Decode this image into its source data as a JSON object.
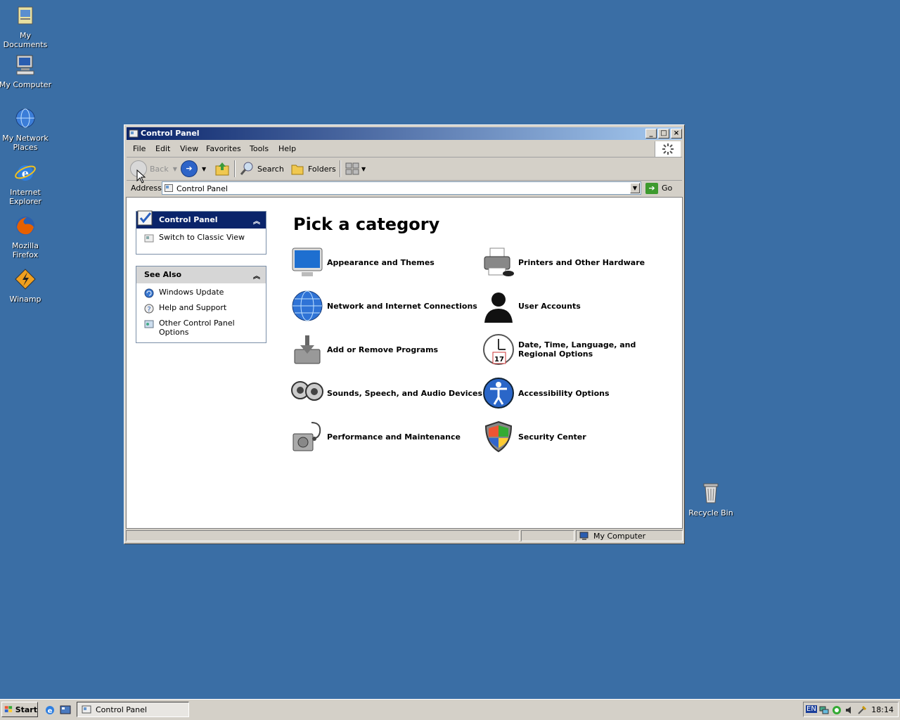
{
  "desktop": {
    "icons": [
      {
        "label": "My Documents"
      },
      {
        "label": "My Computer"
      },
      {
        "label": "My Network Places"
      },
      {
        "label": "Internet Explorer"
      },
      {
        "label": "Mozilla Firefox"
      },
      {
        "label": "Winamp"
      },
      {
        "label": "Recycle Bin"
      }
    ]
  },
  "window": {
    "title": "Control Panel",
    "menu": [
      "File",
      "Edit",
      "View",
      "Favorites",
      "Tools",
      "Help"
    ],
    "toolbar": {
      "back": "Back",
      "search": "Search",
      "folders": "Folders"
    },
    "address": {
      "label": "Address",
      "value": "Control Panel",
      "go": "Go"
    },
    "sidebar": {
      "panel1": {
        "title": "Control Panel",
        "link": "Switch to Classic View"
      },
      "panel2": {
        "title": "See Also",
        "links": [
          "Windows Update",
          "Help and Support",
          "Other Control Panel Options"
        ]
      }
    },
    "heading": "Pick a category",
    "categories": [
      "Appearance and Themes",
      "Printers and Other Hardware",
      "Network and Internet Connections",
      "User Accounts",
      "Add or Remove Programs",
      "Date, Time, Language, and Regional Options",
      "Sounds, Speech, and Audio Devices",
      "Accessibility Options",
      "Performance and Maintenance",
      "Security Center"
    ],
    "status": {
      "zone": "My Computer"
    }
  },
  "taskbar": {
    "start": "Start",
    "task": "Control Panel",
    "tray": {
      "lang": "EN",
      "clock": "18:14"
    }
  }
}
